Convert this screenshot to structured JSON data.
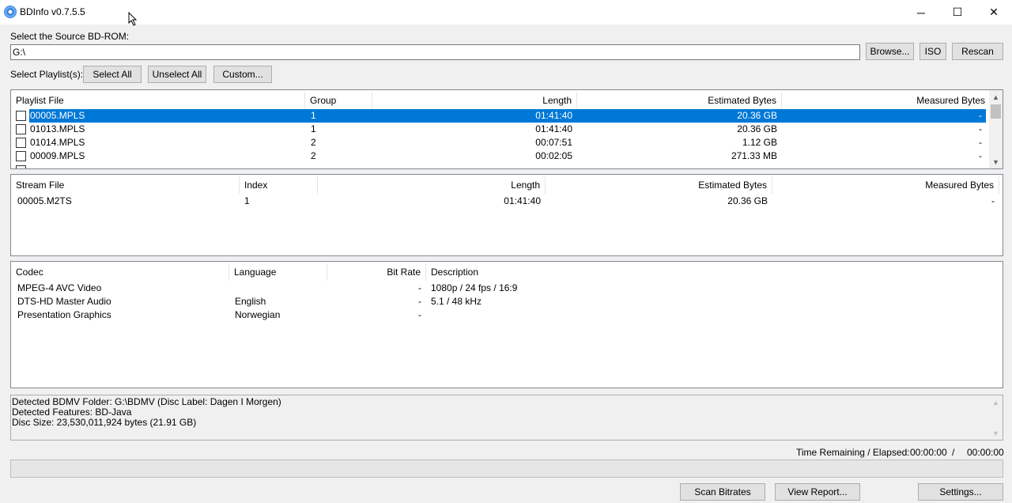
{
  "window": {
    "title": "BDInfo v0.7.5.5",
    "minimize": "─",
    "maximize": "☐",
    "close": "✕"
  },
  "source": {
    "label": "Select the Source BD-ROM:",
    "path": "G:\\",
    "browse": "Browse...",
    "iso": "ISO",
    "rescan": "Rescan"
  },
  "playlist_select": {
    "label": "Select Playlist(s):",
    "select_all": "Select All",
    "unselect_all": "Unselect All",
    "custom": "Custom..."
  },
  "playlists": {
    "headers": [
      "Playlist File",
      "Group",
      "Length",
      "Estimated Bytes",
      "Measured Bytes"
    ],
    "rows": [
      {
        "file": "00005.MPLS",
        "group": "1",
        "length": "01:41:40",
        "est": "20.36 GB",
        "measured": "-",
        "selected": true
      },
      {
        "file": "01013.MPLS",
        "group": "1",
        "length": "01:41:40",
        "est": "20.36 GB",
        "measured": "-"
      },
      {
        "file": "01014.MPLS",
        "group": "2",
        "length": "00:07:51",
        "est": "1.12 GB",
        "measured": "-"
      },
      {
        "file": "00009.MPLS",
        "group": "2",
        "length": "00:02:05",
        "est": "271.33 MB",
        "measured": "-"
      }
    ]
  },
  "streams": {
    "headers": [
      "Stream File",
      "Index",
      "Length",
      "Estimated Bytes",
      "Measured Bytes"
    ],
    "rows": [
      {
        "file": "00005.M2TS",
        "index": "1",
        "length": "01:41:40",
        "est": "20.36 GB",
        "measured": "-"
      }
    ]
  },
  "codecs": {
    "headers": [
      "Codec",
      "Language",
      "Bit Rate",
      "Description"
    ],
    "rows": [
      {
        "codec": "MPEG-4 AVC Video",
        "language": "",
        "bitrate": "-",
        "description": "1080p / 24 fps / 16:9"
      },
      {
        "codec": "DTS-HD Master Audio",
        "language": "English",
        "bitrate": "-",
        "description": "5.1 / 48 kHz"
      },
      {
        "codec": "Presentation Graphics",
        "language": "Norwegian",
        "bitrate": "-",
        "description": ""
      }
    ]
  },
  "info": {
    "lines": [
      "Detected BDMV Folder: G:\\BDMV (Disc Label: Dagen I Morgen)",
      "Detected Features: BD-Java",
      "Disc Size: 23,530,011,924 bytes (21.91 GB)"
    ]
  },
  "status": {
    "label": "Time Remaining / Elapsed:",
    "remaining": "00:00:00",
    "sep": "/",
    "elapsed": "00:00:00"
  },
  "actions": {
    "scan": "Scan Bitrates",
    "report": "View Report...",
    "settings": "Settings..."
  }
}
